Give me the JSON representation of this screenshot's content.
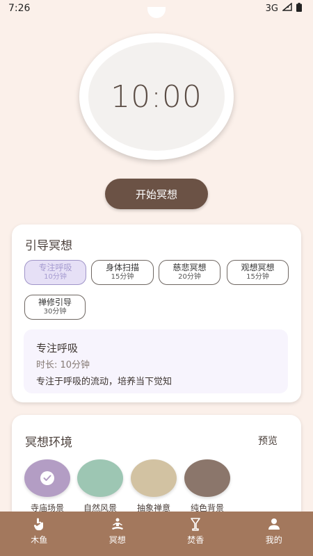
{
  "status": {
    "time": "7:26",
    "network": "3G"
  },
  "timer": {
    "display": "10:00"
  },
  "start_button": {
    "label": "开始冥想"
  },
  "guided": {
    "title": "引导冥想",
    "options": [
      {
        "name": "专注呼吸",
        "duration": "10分钟",
        "selected": true
      },
      {
        "name": "身体扫描",
        "duration": "15分钟",
        "selected": false
      },
      {
        "name": "慈悲冥想",
        "duration": "20分钟",
        "selected": false
      },
      {
        "name": "观想冥想",
        "duration": "15分钟",
        "selected": false
      },
      {
        "name": "禅修引导",
        "duration": "30分钟",
        "selected": false
      }
    ],
    "detail": {
      "title": "专注呼吸",
      "duration": "时长: 10分钟",
      "description": "专注于呼吸的流动，培养当下觉知"
    }
  },
  "environment": {
    "title": "冥想环境",
    "preview_label": "预览",
    "scenes": [
      {
        "label": "寺庙场景",
        "color": "#b39dc4",
        "selected": true
      },
      {
        "label": "自然风景",
        "color": "#9dc6b3",
        "selected": false
      },
      {
        "label": "抽象禅意",
        "color": "#d2c2a2",
        "selected": false
      },
      {
        "label": "纯色背景",
        "color": "#8b766b",
        "selected": false
      }
    ]
  },
  "nav": {
    "items": [
      {
        "label": "木鱼",
        "icon": "hand-tap-icon"
      },
      {
        "label": "冥想",
        "icon": "meditation-icon",
        "active": true
      },
      {
        "label": "焚香",
        "icon": "incense-icon"
      },
      {
        "label": "我的",
        "icon": "person-icon"
      }
    ]
  }
}
